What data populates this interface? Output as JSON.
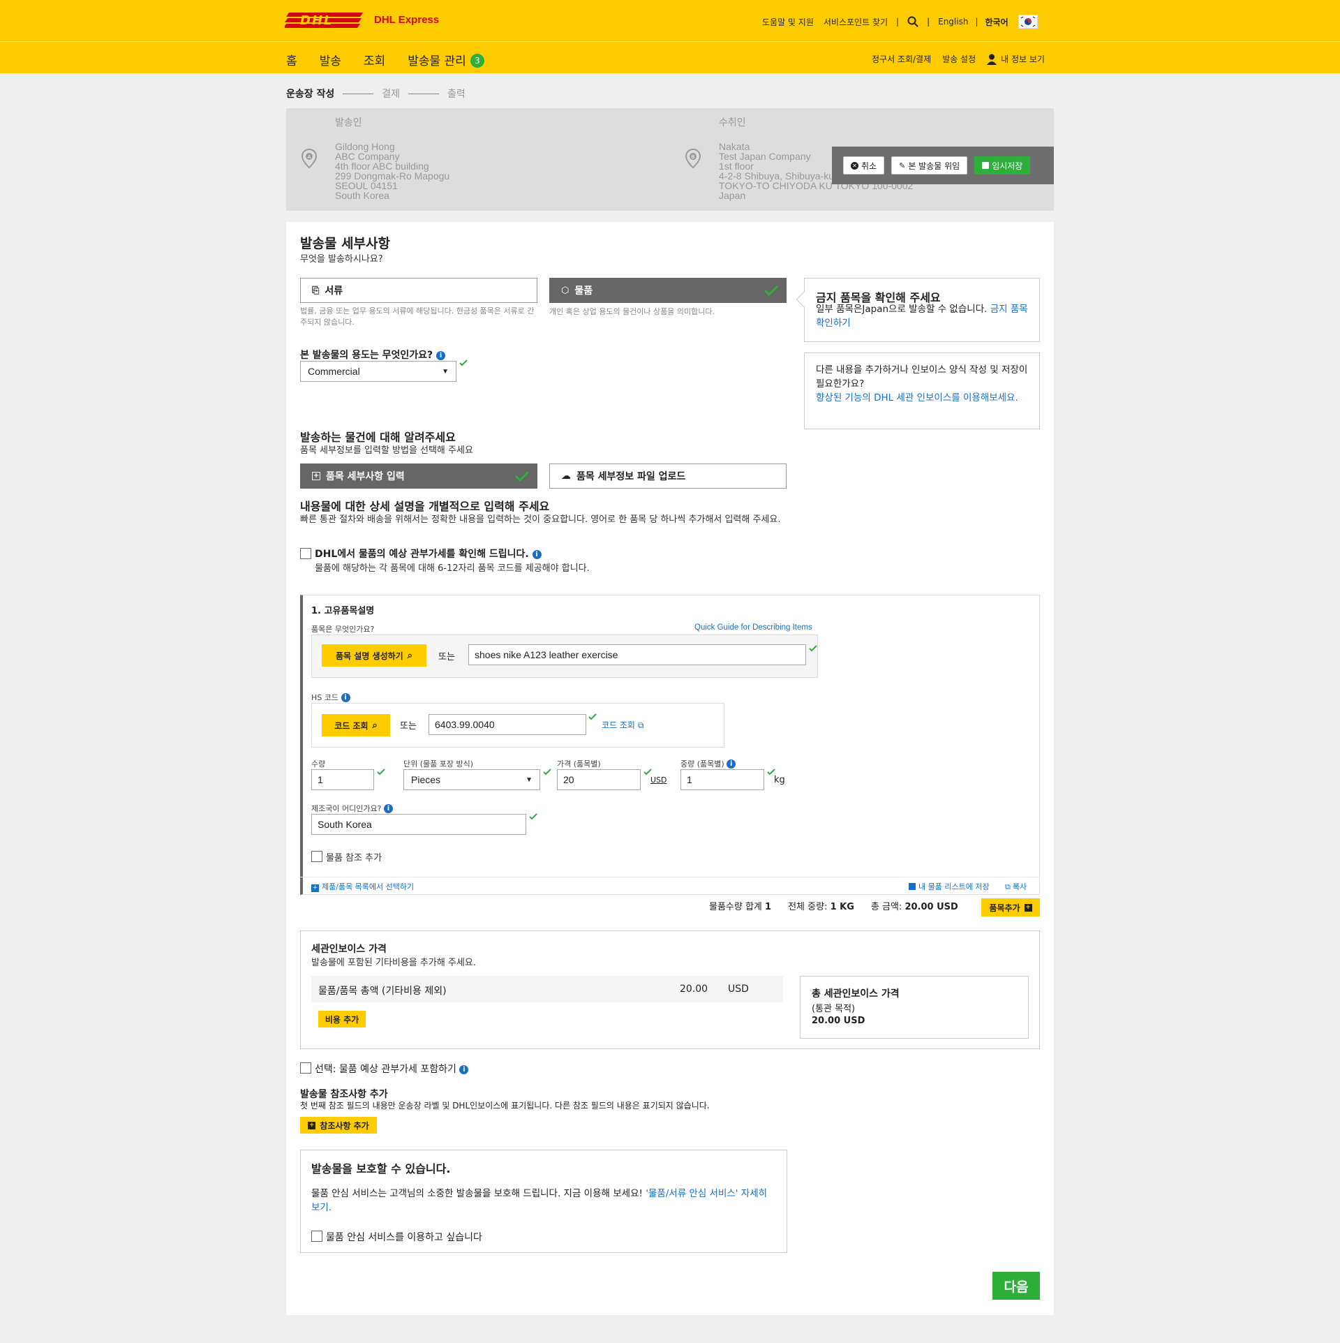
{
  "header": {
    "brand": "DHL Express",
    "links": [
      "도움말 및 지원",
      "서비스포인트 찾기"
    ],
    "lang_en": "English",
    "lang_ko": "한국어",
    "nav": [
      "홈",
      "발송",
      "조회",
      "발송물 관리"
    ],
    "nav_badge": "3",
    "nav_right": [
      "정구서 조회/결제",
      "발송 설정",
      "내 정보 보기"
    ]
  },
  "steps": [
    "운송장 작성",
    "결제",
    "출력"
  ],
  "sender": {
    "title": "발송인",
    "lines": [
      "Gildong Hong",
      "ABC Company",
      "4th floor ABC building",
      "299 Dongmak-Ro Mapogu",
      "SEOUL 04151",
      "South Korea"
    ]
  },
  "receiver": {
    "title": "수취인",
    "lines": [
      "Nakata",
      "Test Japan Company",
      "1st floor",
      "4-2-8 Shibuya, Shibuya-ku",
      "TOKYO-TO CHIYODA KU TOKYO 100-0002",
      "Japan"
    ]
  },
  "actions": {
    "cancel": "취소",
    "delegate": "본 발송물 위임",
    "save": "임시저장"
  },
  "details": {
    "title": "발송물 세부사항",
    "question": "무엇을 발송하시나요?",
    "doc_label": "서류",
    "doc_desc": "법률, 금융 또는 업무 용도의 서류에 해당됩니다. 현금성 품목은 서류로 간주되지 않습니다.",
    "pkg_label": "물품",
    "pkg_desc": "개인 혹은 상업 용도의 물건이나 상품을 의미합니다.",
    "purpose_label": "본 발송물의 용도는 무엇인가요?",
    "purpose_value": "Commercial"
  },
  "sidebar": {
    "prohibited_title": "금지 품목을 확인해 주세요",
    "prohibited_text": "일부 품목은Japan으로 발송할 수 없습니다. ",
    "prohibited_link": "금지 품목 확인하기",
    "invoice_text": "다른 내용을 추가하거나 인보이스 양식 작성 및 저장이 필요한가요?",
    "invoice_link": "향상된 기능의 DHL 세관 인보이스를 이용해보세요."
  },
  "items": {
    "title": "발송하는 물건에 대해 알려주세요",
    "subtitle": "품목 세부정보를 입력할 방법을 선택해 주세요",
    "manual": "품목 세부사항 입력",
    "upload": "품목 세부정보 파일 업로드",
    "desc_title": "내용물에 대한 상세 설명을 개별적으로 입력해 주세요",
    "desc_text": "빠른 통관 절차와 배송을 위해서는 정확한 내용을 입력하는 것이 중요합니다. 영어로 한 품목 당 하나씩 추가해서 입력해 주세요.",
    "duty_label": "DHL에서 물품의 예상 관부가세를 확인해 드립니다.",
    "duty_sub": "물품에 해당하는 각 품목에 대해 6-12자리 품목 코드를 제공해야 합니다."
  },
  "item1": {
    "title": "1. 고유품목설명",
    "what_label": "품목은 무엇인가요?",
    "guide_link": "Quick Guide for Describing Items",
    "gen_btn": "품목 설명 생성하기",
    "or": "또는",
    "desc_value": "shoes nike A123 leather exercise",
    "hs_label": "HS 코드",
    "code_btn": "코드 조회",
    "hs_value": "6403.99.0040",
    "hs_link": "코드 조회",
    "qty_label": "수량",
    "qty_value": "1",
    "unit_label": "단위 (물품 포장 방식)",
    "unit_value": "Pieces",
    "price_label": "가격 (품목별)",
    "price_value": "20",
    "currency": "USD",
    "weight_label": "중량 (품목별)",
    "weight_value": "1",
    "weight_unit": "kg",
    "origin_label": "제조국이 어디인가요?",
    "origin_value": "South Korea",
    "ref_label": "물품 참조 추가",
    "catalog_link": "제품/품목 목록에서 선택하기",
    "save_link": "내 물품 리스트에 저장",
    "copy_link": "복사"
  },
  "totals": {
    "qty_label": "물품수량 합계",
    "qty_value": "1",
    "weight_label": "전체 중량:",
    "weight_value": "1 KG",
    "amount_label": "총 금액:",
    "amount_value": "20.00 USD",
    "add_item": "품목추가"
  },
  "invoice": {
    "title": "세관인보이스 가격",
    "subtitle": "발송물에 포함된 기타비용을 추가해 주세요.",
    "row_label": "물품/품목 총액 (기타비용 제외)",
    "row_value": "20.00",
    "row_currency": "USD",
    "add_cost": "비용 추가",
    "total_title": "총 세관인보이스 가격",
    "total_sub": "(통관 목적)",
    "total_value": "20.00 USD"
  },
  "optional_duty": "선택: 물품 예상 관부가세 포함하기",
  "reference": {
    "title": "발송물 참조사항 추가",
    "text": "첫 번째 참조 필드의 내용만 운송장 라벨 및 DHL인보이스에 표기됩니다. 다른 참조 필드의 내용은 표기되지 않습니다.",
    "add": "참조사항 추가"
  },
  "protect": {
    "title": "발송물을 보호할 수 있습니다.",
    "text": "물품 안심 서비스는 고객님의 소중한 발송물을 보호해 드립니다. 지금 이용해 보세요! ",
    "link": "'물품/서류 안심 서비스' 자세히 보기.",
    "checkbox": "물품 안심 서비스를 이용하고 싶습니다"
  },
  "next": "다음",
  "colors": {
    "dhl_yellow": "#ffcc00",
    "dhl_red": "#d40511",
    "green": "#2eaf3a",
    "link": "#1a6fc4"
  }
}
